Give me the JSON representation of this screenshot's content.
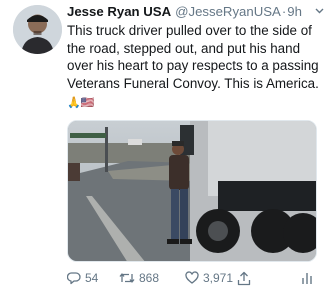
{
  "tweet": {
    "author": {
      "display_name": "Jesse Ryan USA",
      "handle": "@JesseRyanUSA",
      "avatar_icon": "user-avatar-photo"
    },
    "separator": "·",
    "time": "9h",
    "menu_icon": "chevron-down-icon",
    "text": "This truck driver pulled over to the side of the road, stepped out, and put his hand over his heart to pay respects to a passing Veterans Funeral Convoy. This is America.",
    "emojis": "🙏🇺🇸",
    "media": {
      "type": "photo",
      "description_icon": "photo-truck-driver-roadside"
    },
    "actions": {
      "reply_count": "54",
      "retweet_count": "868",
      "like_count": "3,971",
      "reply_icon": "reply-icon",
      "retweet_icon": "retweet-icon",
      "like_icon": "heart-icon",
      "share_icon": "share-icon",
      "analytics_icon": "analytics-icon"
    },
    "colors": {
      "text": "#14171a",
      "secondary": "#657786",
      "border": "#e1e8ed"
    }
  }
}
